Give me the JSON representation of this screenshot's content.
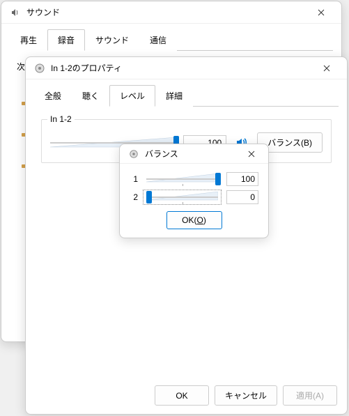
{
  "sound_window": {
    "title": "サウンド",
    "tabs": [
      "再生",
      "録音",
      "サウンド",
      "通信"
    ],
    "active_tab_index": 1,
    "content_label_partial": "次"
  },
  "properties_window": {
    "title": "In 1-2のプロパティ",
    "tabs": [
      "全般",
      "聴く",
      "レベル",
      "詳細"
    ],
    "active_tab_index": 2,
    "level_group": {
      "legend": "In 1-2",
      "value": 100,
      "balance_button_label": "バランス(B)"
    },
    "buttons": {
      "ok": "OK",
      "cancel": "キャンセル",
      "apply": "適用(A)"
    }
  },
  "balance_dialog": {
    "title": "バランス",
    "channels": [
      {
        "label": "1",
        "value": 100,
        "position_pct": 100
      },
      {
        "label": "2",
        "value": 0,
        "position_pct": 0
      }
    ],
    "ok_label_prefix": "OK(",
    "ok_underline": "O",
    "ok_label_suffix": ")"
  }
}
